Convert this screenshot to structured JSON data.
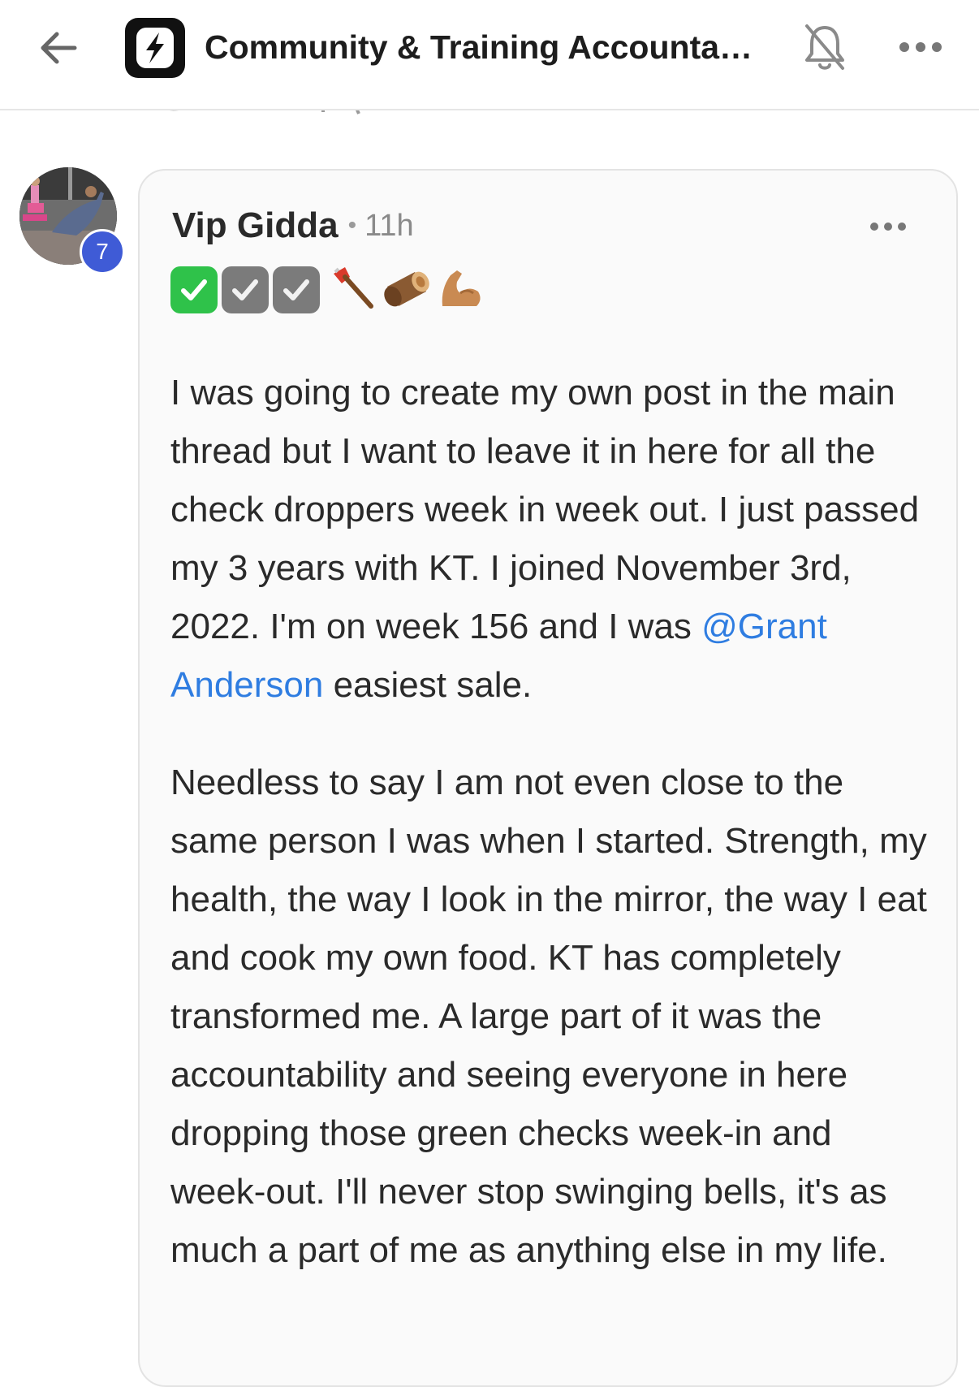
{
  "header": {
    "back_icon": "arrow-left-icon",
    "logo_icon": "lightning-bolt-logo-icon",
    "title": "Community & Training Accountabi...",
    "bell_icon": "bell-off-icon",
    "more_icon": "more-horizontal-icon"
  },
  "post": {
    "avatar_icon": "user-avatar-photo",
    "level": "7",
    "author": "Vip Gidda",
    "separator": "•",
    "time": "11h",
    "more_icon": "more-horizontal-icon",
    "emoji_icons": [
      "green-check-emoji",
      "gray-check-emoji",
      "gray-check-emoji",
      "axe-emoji",
      "log-emoji",
      "flexed-biceps-emoji"
    ],
    "paragraph1_part1": "I was going to create my own post in the main thread but I want to leave it in here for all the check droppers week in week out. I just passed my 3 years with KT. I joined November 3rd, 2022. I'm on week 156 and I was ",
    "mention": "@Grant Anderson",
    "paragraph1_part2": " easiest sale.",
    "paragraph2": "Needless to say I am not even close to the same person I was when I started. Strength, my health, the way I look in the mirror, the way I eat and cook my own food. KT has completely transformed me. A large part of it was the accountability and seeing everyone in here dropping those green checks week-in and week-out. I'll never stop swinging bells, it's as much a part of me as anything else in my life."
  },
  "colors": {
    "accent_mention": "#2f7de1",
    "level_badge": "#3f5bd6",
    "check_green": "#2fc24a"
  }
}
